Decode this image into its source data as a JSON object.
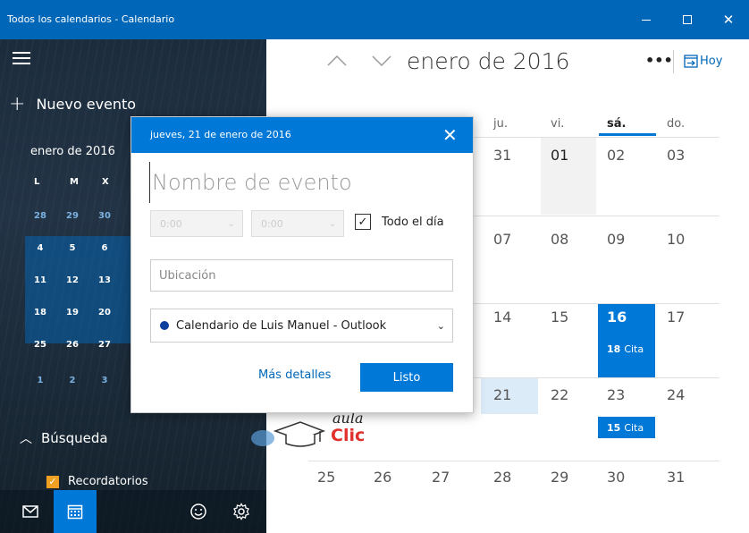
{
  "window": {
    "title": "Todos los calendarios - Calendario"
  },
  "sidebar": {
    "new_event_label": "Nuevo evento",
    "mini_calendar": {
      "title": "enero de 2016",
      "weekday_headers": [
        "L",
        "M",
        "X"
      ],
      "rows": [
        [
          "28",
          "29",
          "30"
        ],
        [
          "4",
          "5",
          "6"
        ],
        [
          "11",
          "12",
          "13"
        ],
        [
          "18",
          "19",
          "20"
        ],
        [
          "25",
          "26",
          "27"
        ],
        [
          "1",
          "2",
          "3"
        ]
      ]
    },
    "search_label": "Búsqueda",
    "reminders_label": "Recordatorios",
    "reminders_checked": true
  },
  "toolbar": {
    "month_title": "enero de 2016",
    "more_label": "•••",
    "today_label": "Hoy"
  },
  "calendar": {
    "weekday_headers": [
      "ju.",
      "vi.",
      "sá.",
      "do."
    ],
    "today_column": "sá.",
    "weeks": [
      [
        "31",
        "01",
        "02",
        "03"
      ],
      [
        "07",
        "08",
        "09",
        "10"
      ],
      [
        "14",
        "15",
        "16",
        "17"
      ],
      [
        "21",
        "22",
        "23",
        "24"
      ],
      [
        "28",
        "29",
        "30",
        "31"
      ]
    ],
    "last_row_extra": [
      "25",
      "26",
      "27"
    ],
    "events": [
      {
        "day": "16",
        "time": "18",
        "label": "Cita"
      },
      {
        "day": "23",
        "time": "15",
        "label": "Cita"
      }
    ],
    "accent_color": "#0078d7"
  },
  "dialog": {
    "date_label": "jueves, 21 de enero de 2016",
    "name_placeholder": "Nombre de evento",
    "start_time": "0:00",
    "end_time": "0:00",
    "all_day_label": "Todo el día",
    "all_day_checked": true,
    "location_placeholder": "Ubicación",
    "calendar_option": "Calendario de Luis Manuel - Outlook",
    "more_details_label": "Más detalles",
    "done_label": "Listo"
  },
  "logo": {
    "line1": "aula",
    "line2": "Clic"
  }
}
